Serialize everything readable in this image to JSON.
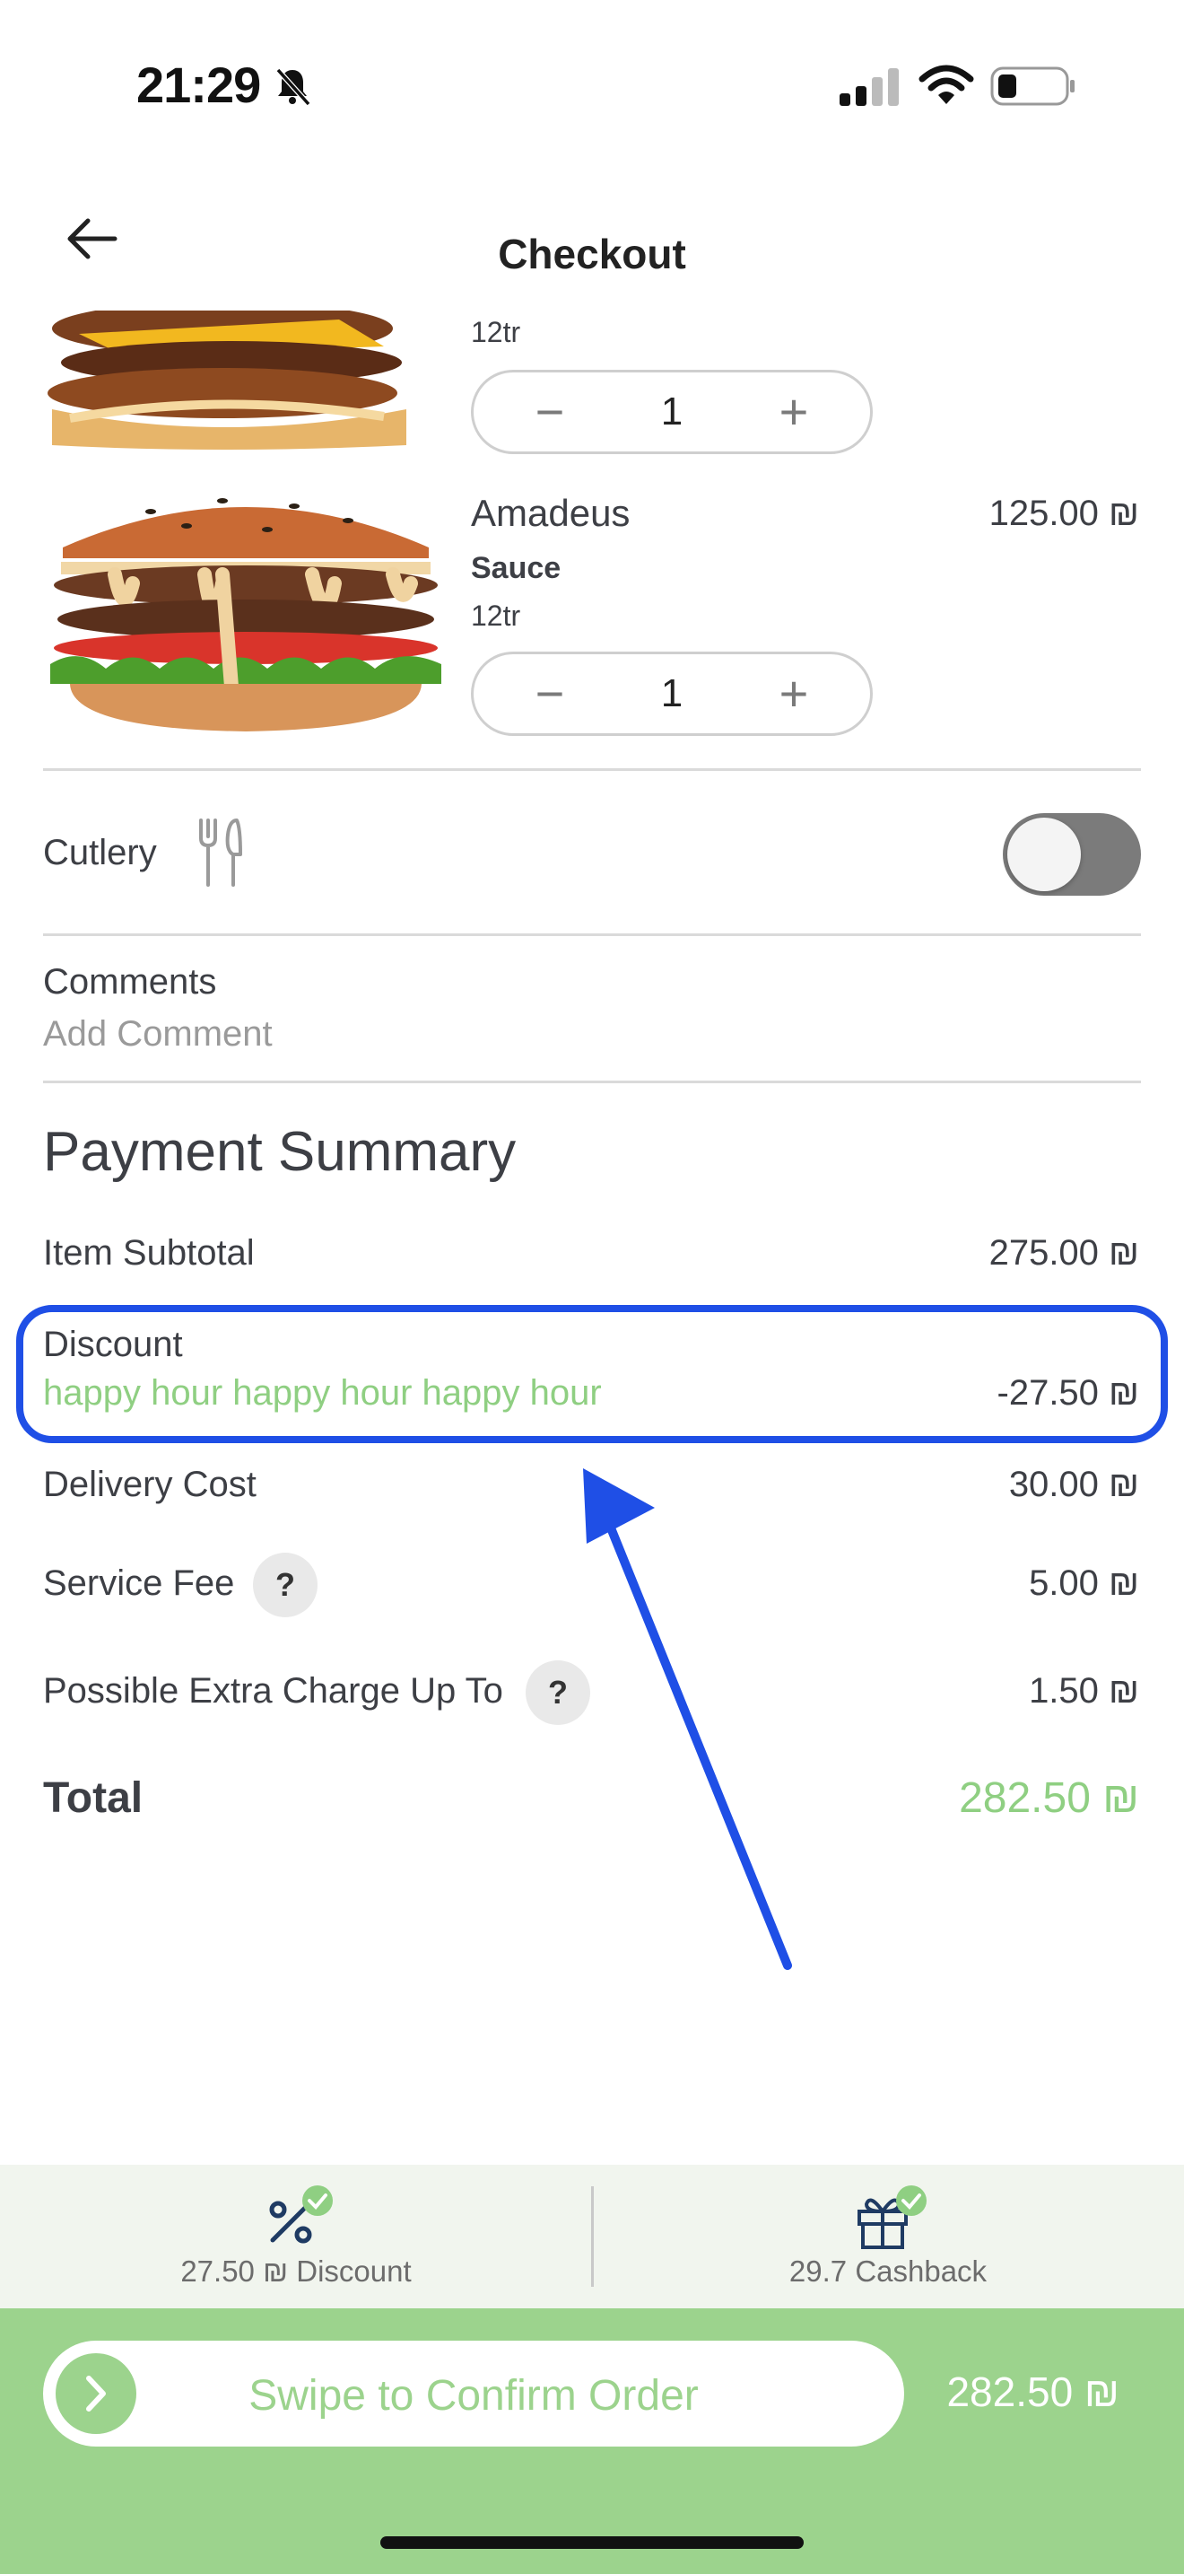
{
  "status_bar": {
    "time": "21:29"
  },
  "header": {
    "title": "Checkout"
  },
  "cart": {
    "items": [
      {
        "name": "",
        "option": "",
        "size": "12tr",
        "quantity": "1",
        "price": ""
      },
      {
        "name": "Amadeus",
        "option": "Sauce",
        "size": "12tr",
        "quantity": "1",
        "price": "125.00 ₪"
      }
    ],
    "minus_symbol": "−",
    "plus_symbol": "+"
  },
  "cutlery": {
    "label": "Cutlery",
    "enabled": false
  },
  "comments": {
    "label": "Comments",
    "placeholder": "Add Comment"
  },
  "payment_summary": {
    "title": "Payment Summary",
    "subtotal_label": "Item Subtotal",
    "subtotal_value": "275.00 ₪",
    "discount_label": "Discount",
    "discount_name": "happy hour happy hour happy hour",
    "discount_value": "-27.50 ₪",
    "delivery_label": "Delivery Cost",
    "delivery_value": "30.00 ₪",
    "service_label": "Service Fee",
    "service_value": "5.00 ₪",
    "extra_label": "Possible Extra Charge Up To",
    "extra_value": "1.50 ₪",
    "help_symbol": "?",
    "total_label": "Total",
    "total_value": "282.50 ₪"
  },
  "benefits": {
    "discount_label": "27.50 ₪ Discount",
    "cashback_label": "29.7 Cashback"
  },
  "swipe": {
    "label": "Swipe to Confirm Order",
    "total": "282.50 ₪"
  },
  "colors": {
    "accent_green": "#9cd38d",
    "highlight_blue": "#1f4fe6",
    "text_dark": "#3d3f45",
    "benefit_icon": "#1f3b63"
  }
}
